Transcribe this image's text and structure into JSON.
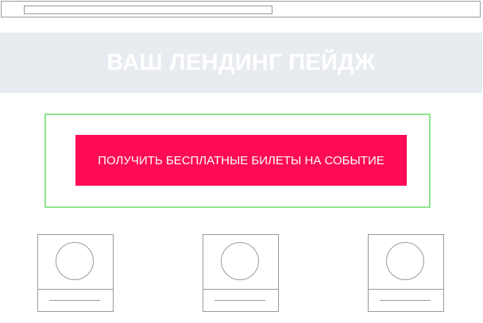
{
  "hero": {
    "title": "ВАШ ЛЕНДИНГ ПЕЙДЖ"
  },
  "cta": {
    "label": "ПОЛУЧИТЬ БЕСПЛАТНЫЕ БИЛЕТЫ НА СОБЫТИЕ"
  },
  "colors": {
    "cta_background": "#ff0a54",
    "hero_background": "#e8ebef",
    "cta_highlight_border": "#8fe58f",
    "wireframe_stroke": "#9a9a9a"
  },
  "cards": [
    {
      "icon": "avatar-circle"
    },
    {
      "icon": "avatar-circle"
    },
    {
      "icon": "avatar-circle"
    }
  ]
}
